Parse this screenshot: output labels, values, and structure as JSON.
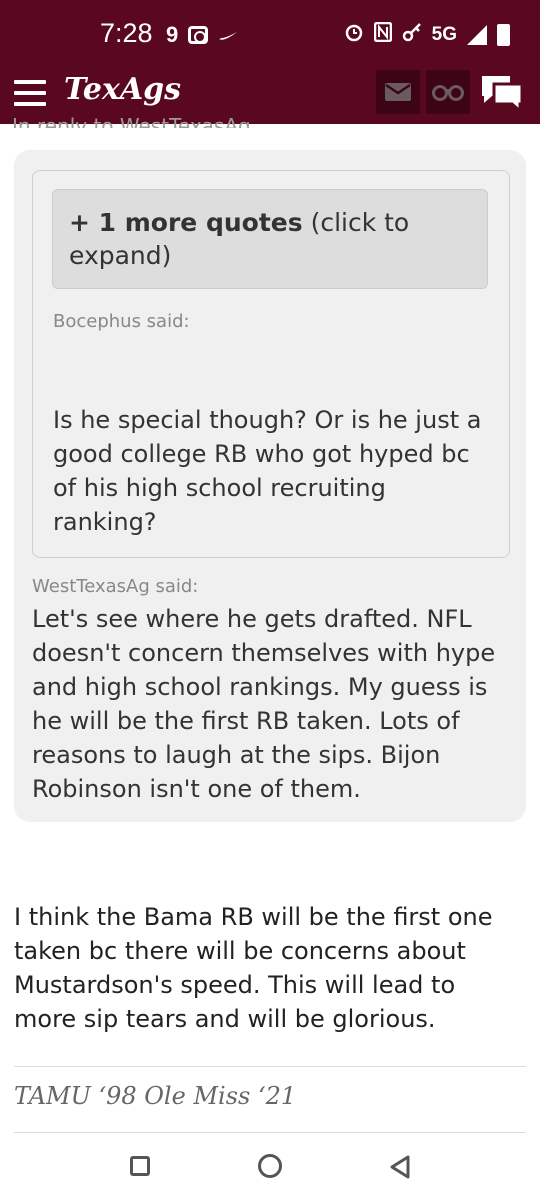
{
  "status_bar": {
    "time": "7:28",
    "left_badge": "9",
    "network": "5G"
  },
  "app_header": {
    "logo": "TexAgs",
    "icons": [
      "menu-icon",
      "mail-icon",
      "binoculars-icon",
      "chat-icon"
    ]
  },
  "post": {
    "in_reply_to": "In reply to WestTexasAg",
    "expand_quotes_bold": "+ 1 more quotes",
    "expand_quotes_rest": " (click to expand)",
    "quote1_author": "Bocephus said:",
    "quote1_text": "Is he special though? Or is he just a good college RB who got hyped bc of his high school recruiting ranking?",
    "quote2_author": "WestTexasAg said:",
    "quote2_text": "Let's see where he gets drafted. NFL doesn't concern themselves with hype and high school rankings. My guess is he will be the first RB taken. Lots of reasons to laugh at the sips. Bijon Robinson isn't one of them.",
    "reply_text": "I think the Bama RB will be the first one taken bc there will be concerns about Mustardson's speed. This will lead to more sip tears and will be glorious.",
    "signature": "TAMU ‘98 Ole Miss ‘21"
  },
  "colors": {
    "header_maroon": "#5a0820",
    "header_button": "#3c0414",
    "card_bg": "#f0f0f0",
    "expand_bg": "#dddddd"
  },
  "nav_bar": {
    "icons": [
      "recent-apps-icon",
      "home-icon",
      "back-icon"
    ]
  }
}
